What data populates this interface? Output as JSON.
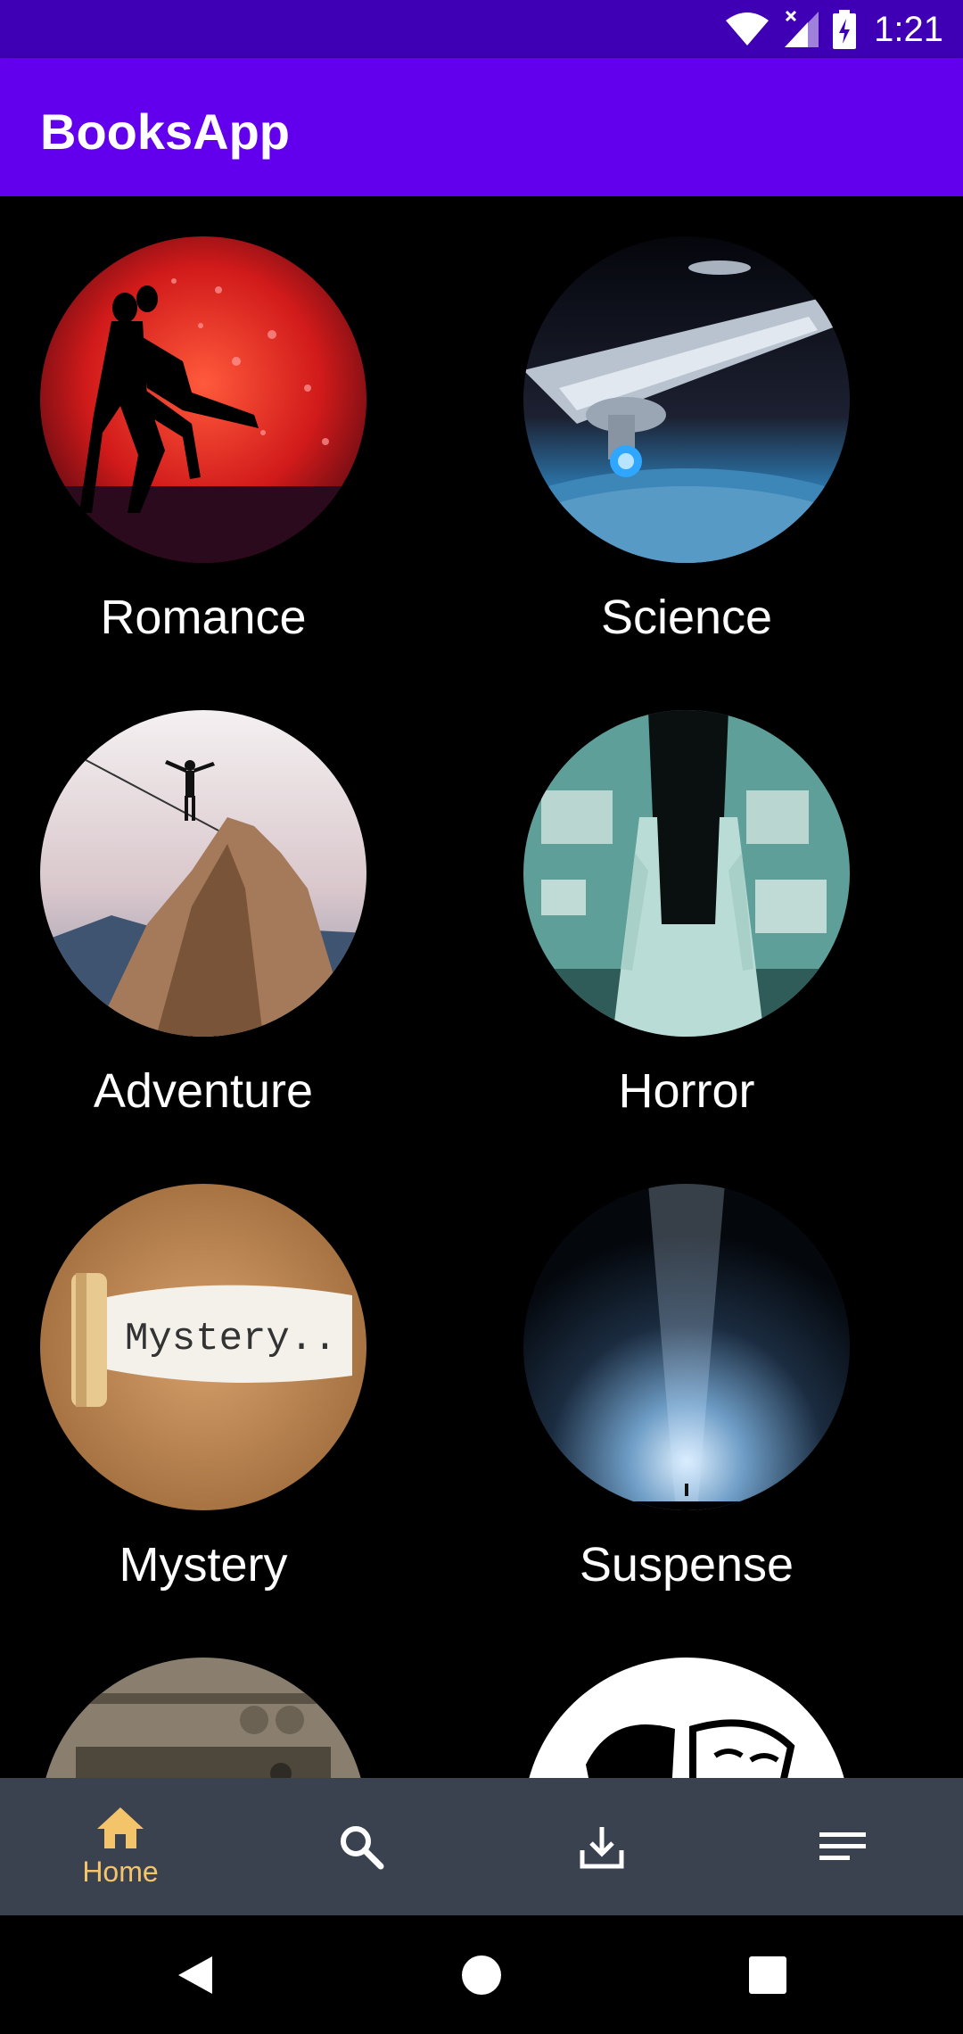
{
  "status_bar": {
    "time": "1:21"
  },
  "app_bar": {
    "title": "BooksApp"
  },
  "categories": [
    {
      "label": "Romance"
    },
    {
      "label": "Science"
    },
    {
      "label": "Adventure"
    },
    {
      "label": "Horror"
    },
    {
      "label": "Mystery",
      "image_text": "Mystery.."
    },
    {
      "label": "Suspense"
    },
    {
      "label": ""
    },
    {
      "label": ""
    }
  ],
  "bottom_nav": {
    "active_color": "#f4c46b",
    "items": [
      {
        "icon": "home-icon",
        "label": "Home",
        "active": true
      },
      {
        "icon": "search-icon",
        "active": false
      },
      {
        "icon": "download-icon",
        "active": false
      },
      {
        "icon": "menu-icon",
        "active": false
      }
    ]
  },
  "colors": {
    "status_bar": "#3f00b5",
    "app_bar": "#6200ee",
    "nav_bg": "#3a4250"
  }
}
